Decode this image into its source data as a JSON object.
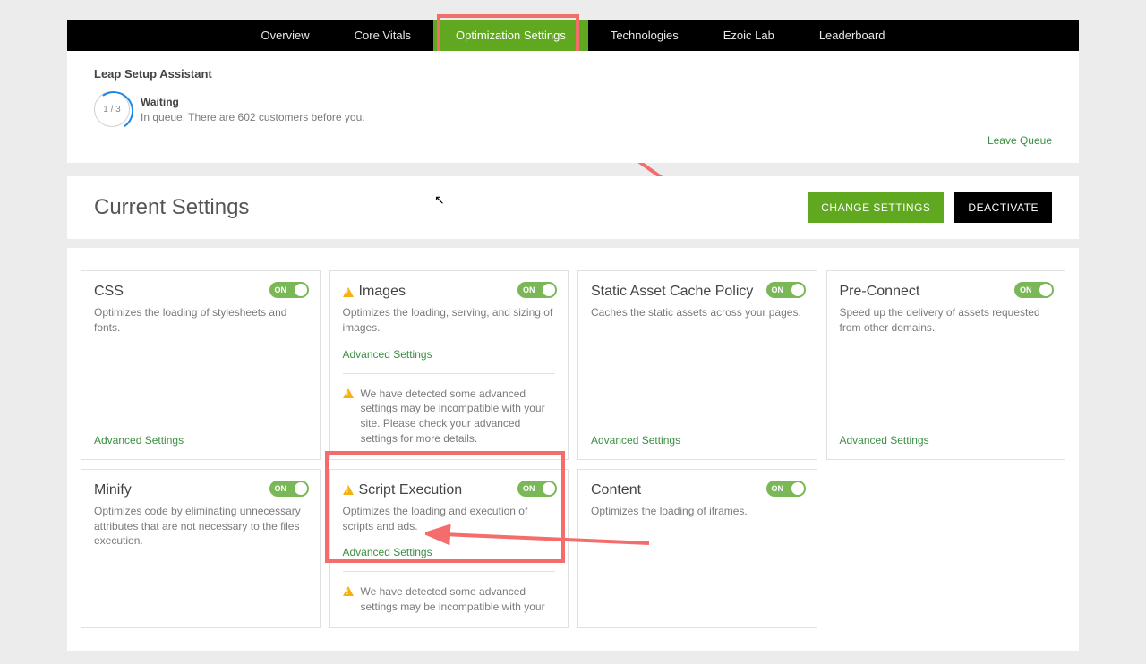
{
  "topbar": {
    "tabs": [
      "Overview",
      "Core Vitals",
      "Optimization Settings",
      "Technologies",
      "Ezoic Lab",
      "Leaderboard"
    ],
    "active_index": 2
  },
  "assistant": {
    "title": "Leap Setup Assistant",
    "progress": "1 / 3",
    "status_title": "Waiting",
    "status_sub": "In queue. There are 602 customers before you.",
    "leave_label": "Leave Queue"
  },
  "settings_header": {
    "title": "Current Settings",
    "change_btn": "CHANGE SETTINGS",
    "deactivate_btn": "DEACTIVATE"
  },
  "common": {
    "toggle_label": "ON",
    "advanced": "Advanced Settings",
    "warning_text": "We have detected some advanced settings may be incompatible with your site. Please check your advanced settings for more details.",
    "warning_text_short": "We have detected some advanced settings may be incompatible with your"
  },
  "tiles": {
    "css": {
      "title": "CSS",
      "desc": "Optimizes the loading of stylesheets and fonts."
    },
    "images": {
      "title": "Images",
      "desc": "Optimizes the loading, serving, and sizing of images."
    },
    "static": {
      "title": "Static Asset Cache Policy",
      "desc": "Caches the static assets across your pages."
    },
    "preconnect": {
      "title": "Pre-Connect",
      "desc": "Speed up the delivery of assets requested from other domains."
    },
    "minify": {
      "title": "Minify",
      "desc": "Optimizes code by eliminating unnecessary attributes that are not necessary to the files execution."
    },
    "script": {
      "title": "Script Execution",
      "desc": "Optimizes the loading and execution of scripts and ads."
    },
    "content": {
      "title": "Content",
      "desc": "Optimizes the loading of iframes."
    }
  }
}
